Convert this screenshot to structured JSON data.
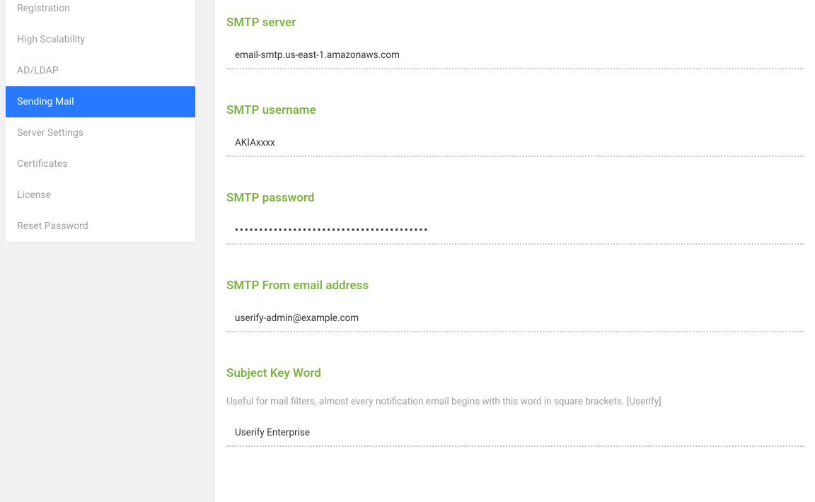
{
  "sidebar": {
    "items": [
      {
        "label": "Registration",
        "active": false
      },
      {
        "label": "High Scalability",
        "active": false
      },
      {
        "label": "AD/LDAP",
        "active": false
      },
      {
        "label": "Sending Mail",
        "active": true
      },
      {
        "label": "Server Settings",
        "active": false
      },
      {
        "label": "Certificates",
        "active": false
      },
      {
        "label": "License",
        "active": false
      },
      {
        "label": "Reset Password",
        "active": false
      }
    ]
  },
  "form": {
    "smtp_server": {
      "label": "SMTP server",
      "value": "email-smtp.us-east-1.amazonaws.com"
    },
    "smtp_username": {
      "label": "SMTP username",
      "value": "AKIAxxxx"
    },
    "smtp_password": {
      "label": "SMTP password",
      "value": "••••••••••••••••••••••••••••••••••••••••"
    },
    "smtp_from": {
      "label": "SMTP From email address",
      "value": "userify-admin@example.com"
    },
    "subject_keyword": {
      "label": "Subject Key Word",
      "hint": "Useful for mail filters, almost every notification email begins with this word in square brackets. [Userify]",
      "value": "Userify Enterprise"
    }
  }
}
